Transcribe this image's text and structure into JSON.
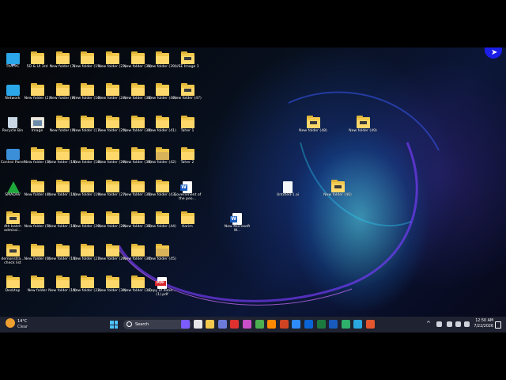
{
  "desktop": {
    "icons": [
      {
        "label": "This PC",
        "kind": "pc"
      },
      {
        "label": "Network",
        "kind": "net"
      },
      {
        "label": "Recycle Bin",
        "kind": "bin"
      },
      {
        "label": "Control Panel",
        "kind": "ctrl"
      },
      {
        "label": "SMADAV",
        "kind": "smad"
      },
      {
        "label": "4th batch admissi...",
        "kind": "folder-doc"
      },
      {
        "label": "demonstra... check list",
        "kind": "folder-doc"
      },
      {
        "label": "Desktop",
        "kind": "folder"
      },
      {
        "label": "5D & UI 3rd",
        "kind": "folder"
      },
      {
        "label": "New folder (2)",
        "kind": "folder"
      },
      {
        "label": "Image",
        "kind": "img"
      },
      {
        "label": "New folder (3)",
        "kind": "folder"
      },
      {
        "label": "New folder (4)",
        "kind": "folder"
      },
      {
        "label": "New folder (5)",
        "kind": "folder"
      },
      {
        "label": "New folder (6)",
        "kind": "folder"
      },
      {
        "label": "New folder",
        "kind": "folder"
      },
      {
        "label": "New folder (7)",
        "kind": "folder"
      },
      {
        "label": "New folder (8)",
        "kind": "folder"
      },
      {
        "label": "New folder (9)",
        "kind": "folder"
      },
      {
        "label": "New folder (10)",
        "kind": "folder"
      },
      {
        "label": "New folder (11)",
        "kind": "folder"
      },
      {
        "label": "New folder (12)",
        "kind": "folder"
      },
      {
        "label": "New folder (13)",
        "kind": "folder"
      },
      {
        "label": "New folder (14)",
        "kind": "folder"
      },
      {
        "label": "New folder (15)",
        "kind": "folder"
      },
      {
        "label": "New folder (16)",
        "kind": "folder"
      },
      {
        "label": "New folder (17)",
        "kind": "folder"
      },
      {
        "label": "New folder (18)",
        "kind": "folder"
      },
      {
        "label": "New folder (19)",
        "kind": "folder"
      },
      {
        "label": "New folder (20)",
        "kind": "folder"
      },
      {
        "label": "New folder (21)",
        "kind": "folder"
      },
      {
        "label": "New folder (22)",
        "kind": "folder"
      },
      {
        "label": "New folder (23)",
        "kind": "folder"
      },
      {
        "label": "New folder (24)",
        "kind": "folder"
      },
      {
        "label": "New folder (25)",
        "kind": "folder"
      },
      {
        "label": "New folder (26)",
        "kind": "folder"
      },
      {
        "label": "New folder (27)",
        "kind": "folder"
      },
      {
        "label": "New folder (28)",
        "kind": "folder"
      },
      {
        "label": "New folder (29)",
        "kind": "folder"
      },
      {
        "label": "New folder (30)",
        "kind": "folder"
      },
      {
        "label": "New folder (31)",
        "kind": "folder"
      },
      {
        "label": "New folder (32)",
        "kind": "folder"
      },
      {
        "label": "New folder (33)",
        "kind": "folder"
      },
      {
        "label": "New folder (34)",
        "kind": "folder"
      },
      {
        "label": "New folder (35)",
        "kind": "folder"
      },
      {
        "label": "New folder (36)",
        "kind": "folder"
      },
      {
        "label": "New folder (37)",
        "kind": "folder"
      },
      {
        "label": "New folder (38)",
        "kind": "folder"
      },
      {
        "label": "New folder (39)",
        "kind": "folder"
      },
      {
        "label": "New folder (40)",
        "kind": "folder"
      },
      {
        "label": "New folder (41)",
        "kind": "folder"
      },
      {
        "label": "New folder (42)",
        "kind": "folder-dark"
      },
      {
        "label": "New folder (43)",
        "kind": "folder"
      },
      {
        "label": "New folder (44)",
        "kind": "folder"
      },
      {
        "label": "New folder (45)",
        "kind": "folder-dark"
      },
      {
        "label": "Copy of dime... (1).pdf",
        "kind": "pdf"
      },
      {
        "label": "USE Image 1",
        "kind": "folder-doc"
      },
      {
        "label": "New folder (47)",
        "kind": "folder-doc"
      },
      {
        "label": "Taher 1",
        "kind": "folder"
      },
      {
        "label": "Taher 2",
        "kind": "folder"
      },
      {
        "label": "Government of the peo...",
        "kind": "word"
      },
      {
        "label": "Karim",
        "kind": "folder"
      },
      {
        "label": "New Microsoft W...",
        "kind": "word"
      },
      {
        "label": "Untitled-1.ai",
        "kind": "doc"
      },
      {
        "label": "New folder (46)",
        "kind": "folder-doc"
      },
      {
        "label": "New folder (48)",
        "kind": "folder-doc"
      },
      {
        "label": "New folder (49)",
        "kind": "folder-doc"
      }
    ]
  },
  "taskbar": {
    "weather": {
      "temp": "14°C",
      "condition": "Clear"
    },
    "search_label": "Search",
    "apps": [
      "copilot-icon",
      "task-view-icon",
      "file-explorer-icon",
      "mail-icon",
      "opera-icon",
      "snipping-icon",
      "chrome-icon",
      "illustrator-icon",
      "powerpoint-icon",
      "edge-icon",
      "outlook-icon",
      "excel-icon",
      "word-icon",
      "edge-dev-icon",
      "photoshop-icon",
      "chrome-alt-icon"
    ],
    "tray_chevron": "^",
    "clock": {
      "time": "12:50 AM",
      "date": "7/22/2026"
    }
  }
}
